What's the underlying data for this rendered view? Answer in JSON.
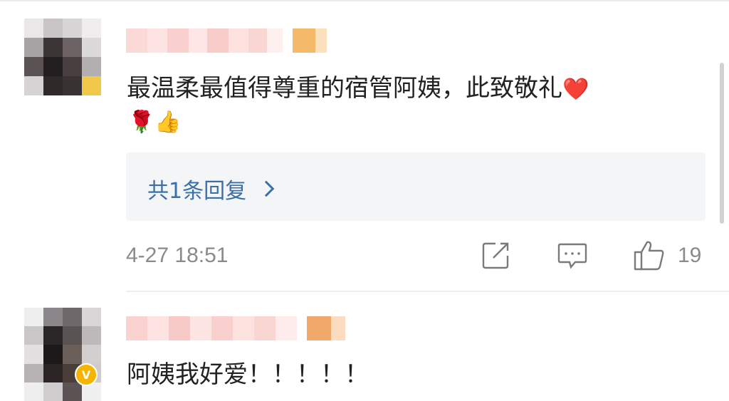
{
  "comments": [
    {
      "text_line1": "最温柔最值得尊重的宿管阿姨，此致敬礼",
      "emoji_heart": "❤️",
      "emoji_line2": "🌹👍",
      "reply_link": "共1条回复",
      "time": "4-27 18:51",
      "like_count": "19",
      "icons": [
        "share-icon",
        "comment-icon",
        "like-icon",
        "chevron-right-icon"
      ]
    },
    {
      "text": "阿姨我好爱！！！！！",
      "verified_badge": "V"
    }
  ],
  "colors": {
    "link": "#3b6fa8",
    "meta_gray": "#8a8a8a",
    "reply_bg": "#f3f5f7",
    "verified": "#f5b400"
  }
}
